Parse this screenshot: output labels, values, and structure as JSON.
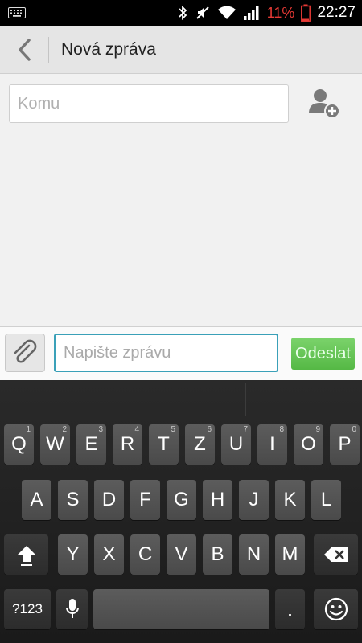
{
  "status_bar": {
    "battery_percent": "11%",
    "time": "22:27",
    "icons": [
      "keyboard-icon",
      "bluetooth-icon",
      "mute-icon",
      "wifi-icon",
      "signal-icon",
      "battery-icon"
    ]
  },
  "header": {
    "title": "Nová zpráva",
    "back_icon": "chevron-left-icon"
  },
  "compose": {
    "to_placeholder": "Komu",
    "add_contact_icon": "add-contact-icon"
  },
  "message_bar": {
    "attach_icon": "paperclip-icon",
    "message_placeholder": "Napište zprávu",
    "send_label": "Odeslat"
  },
  "keyboard": {
    "row1": [
      {
        "label": "Q",
        "hint": "1"
      },
      {
        "label": "W",
        "hint": "2"
      },
      {
        "label": "E",
        "hint": "3"
      },
      {
        "label": "R",
        "hint": "4"
      },
      {
        "label": "T",
        "hint": "5"
      },
      {
        "label": "Z",
        "hint": "6"
      },
      {
        "label": "U",
        "hint": "7"
      },
      {
        "label": "I",
        "hint": "8"
      },
      {
        "label": "O",
        "hint": "9"
      },
      {
        "label": "P",
        "hint": "0"
      }
    ],
    "row2": [
      "A",
      "S",
      "D",
      "F",
      "G",
      "H",
      "J",
      "K",
      "L"
    ],
    "row3": [
      "Y",
      "X",
      "C",
      "V",
      "B",
      "N",
      "M"
    ],
    "symbols_label": "?123",
    "period_label": ".",
    "shift_icon": "shift-icon",
    "backspace_icon": "backspace-icon",
    "mic_icon": "microphone-icon",
    "emoji_icon": "emoji-icon"
  }
}
